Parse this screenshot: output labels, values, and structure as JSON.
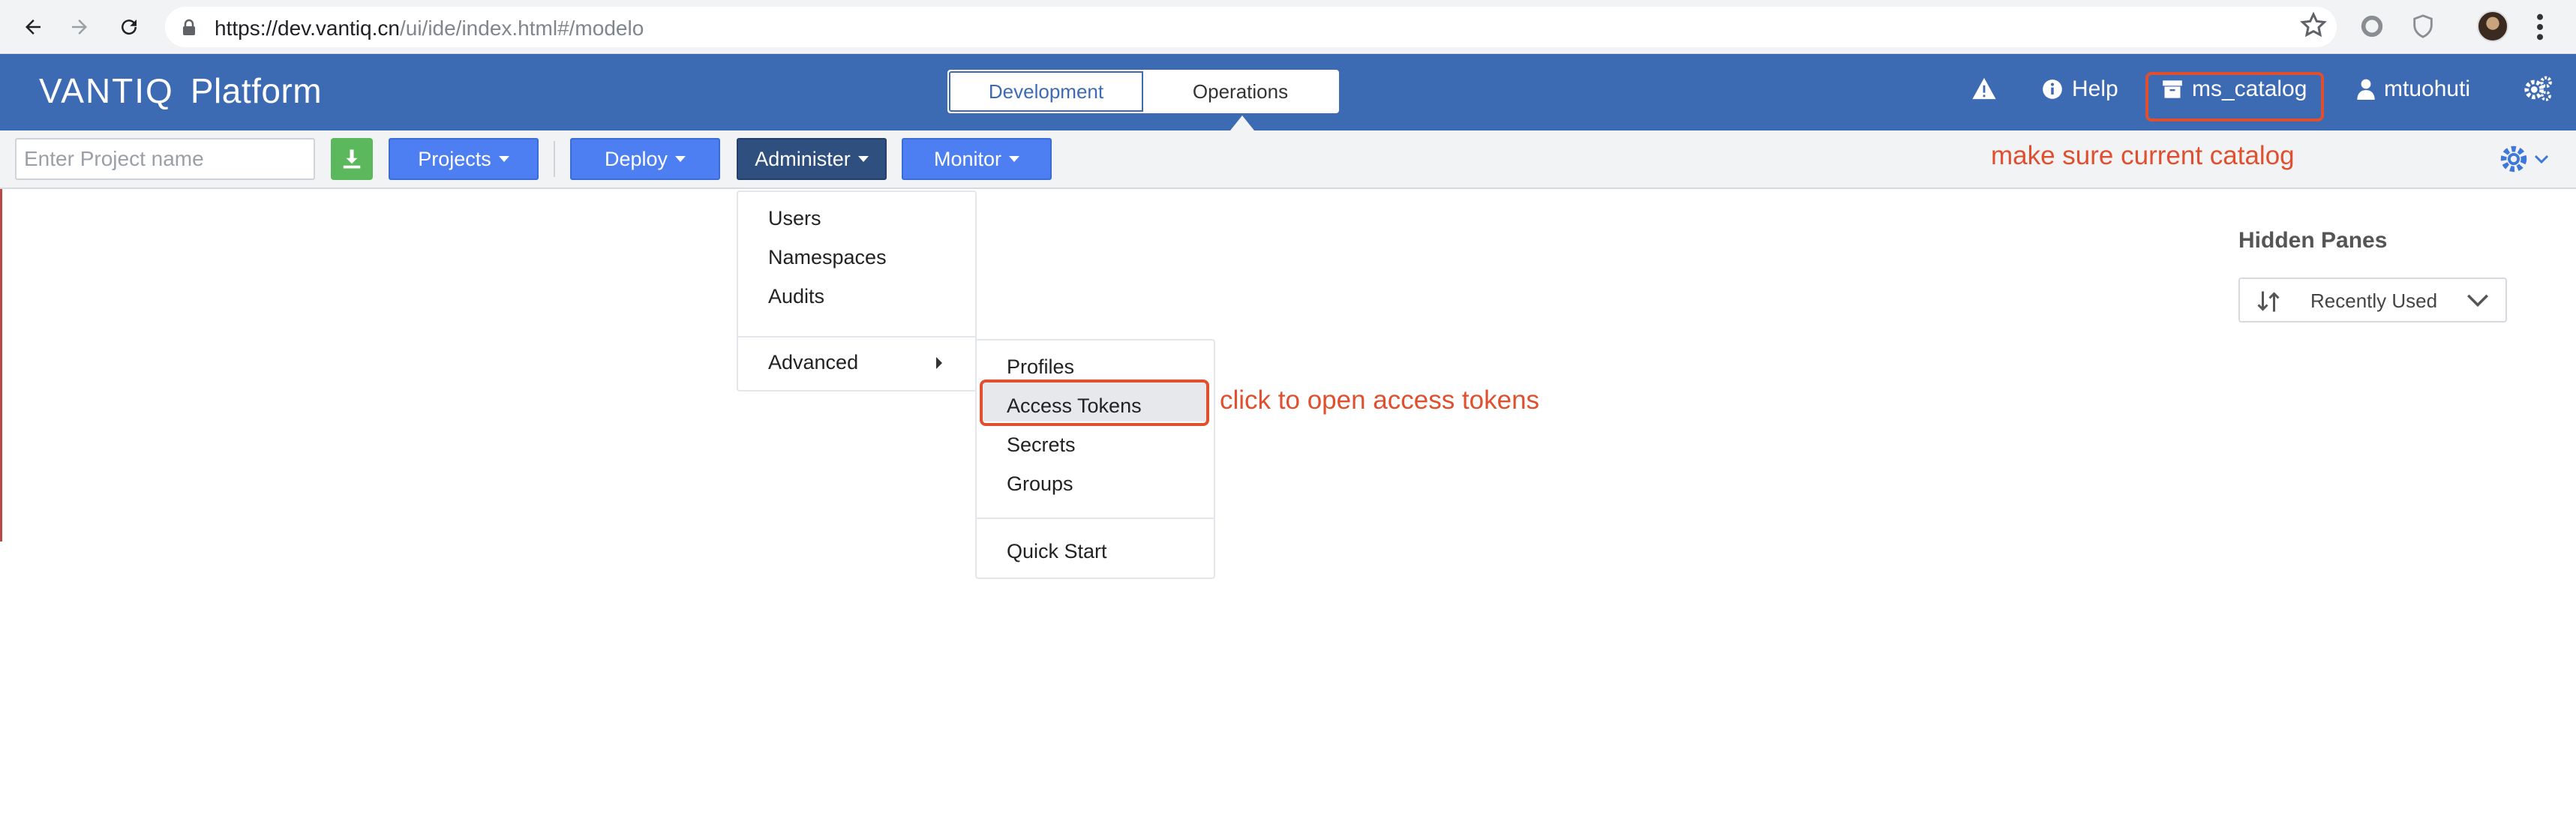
{
  "browser": {
    "url_prefix": "https://dev.vantiq.cn",
    "url_path": "/ui/ide/index.html#/modelo"
  },
  "app": {
    "logo": "VANTIQ",
    "platform": "Platform",
    "modes": [
      "Development",
      "Operations"
    ],
    "active_mode": "Operations",
    "header": {
      "help_label": "Help",
      "catalog_label": "ms_catalog",
      "user_label": "mtuohuti"
    }
  },
  "toolbar": {
    "project_placeholder": "Enter Project name",
    "buttons": [
      {
        "label": "Projects"
      },
      {
        "label": "Deploy"
      },
      {
        "label": "Administer"
      },
      {
        "label": "Monitor"
      }
    ],
    "active_button": "Administer"
  },
  "annotations": {
    "catalog_note": "make sure current catalog",
    "tokens_note": "click to open access tokens"
  },
  "administer_menu": {
    "items": [
      "Users",
      "Namespaces",
      "Audits"
    ],
    "advanced_label": "Advanced"
  },
  "advanced_menu": {
    "items": [
      "Profiles",
      "Access Tokens",
      "Secrets",
      "Groups"
    ],
    "highlighted": "Access Tokens",
    "quick_start": "Quick Start"
  },
  "hidden_panes": {
    "title": "Hidden Panes",
    "sort_label": "Recently Used"
  },
  "colors": {
    "header_blue": "#3d6bb3",
    "button_blue": "#4e7ff2",
    "active_button": "#2f4f7f",
    "download_green": "#5cb85c",
    "annotation_red": "#e0502e"
  },
  "icons": {
    "back": "arrow-left-icon",
    "forward": "arrow-right-icon",
    "reload": "reload-icon",
    "lock": "lock-icon",
    "star": "star-icon",
    "warning": "warning-icon",
    "help": "info-circle-icon",
    "catalog": "archive-box-icon",
    "user": "user-icon",
    "settings": "gears-icon",
    "download": "download-icon",
    "sort": "sort-arrows-icon"
  }
}
